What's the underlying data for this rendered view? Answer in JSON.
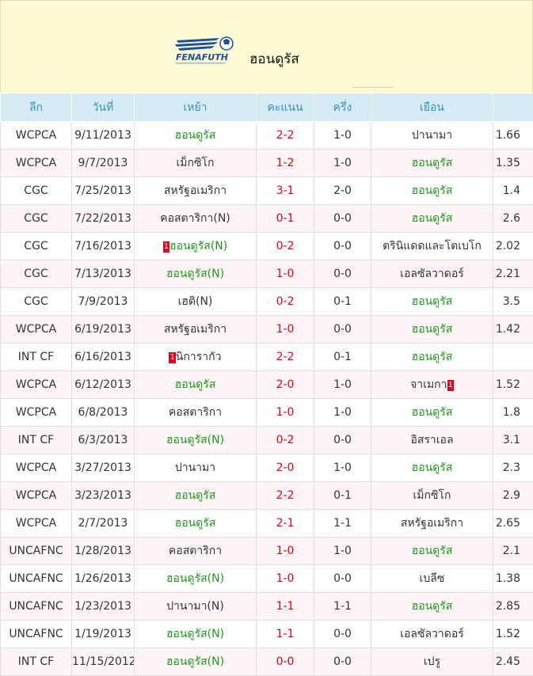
{
  "header": {
    "team_name": "ฮอนดูรัส",
    "logo_text": "FENAFUTH",
    "colors": {
      "background": "#fdfbd4",
      "table_header": "#d6ecf5",
      "header_text": "#3a8fc6",
      "score": "#e4001b",
      "highlight": "#1f9a1f",
      "red_card": "#e4001b"
    }
  },
  "table": {
    "columns": [
      "ลีก",
      "วันที่",
      "เหย้า",
      "คะแนน",
      "ครึ่ง",
      "เยือน",
      ""
    ],
    "rows": [
      {
        "league": "WCPCA",
        "date": "9/11/2013",
        "home": "ฮอนดูรัส",
        "home_hl": true,
        "home_card": "",
        "score": "2-2",
        "half": "1-0",
        "away": "ปานามา",
        "away_hl": false,
        "away_card": "",
        "odds": "1.66"
      },
      {
        "league": "WCPCA",
        "date": "9/7/2013",
        "home": "เม็กซิโก",
        "home_hl": false,
        "home_card": "",
        "score": "1-2",
        "half": "1-0",
        "away": "ฮอนดูรัส",
        "away_hl": true,
        "away_card": "",
        "odds": "1.35"
      },
      {
        "league": "CGC",
        "date": "7/25/2013",
        "home": "สหรัฐอเมริกา",
        "home_hl": false,
        "home_card": "",
        "score": "3-1",
        "half": "2-0",
        "away": "ฮอนดูรัส",
        "away_hl": true,
        "away_card": "",
        "odds": "1.4"
      },
      {
        "league": "CGC",
        "date": "7/22/2013",
        "home": "คอสตาริกา(N)",
        "home_hl": false,
        "home_card": "",
        "score": "0-1",
        "half": "0-0",
        "away": "ฮอนดูรัส",
        "away_hl": true,
        "away_card": "",
        "odds": "2.6"
      },
      {
        "league": "CGC",
        "date": "7/16/2013",
        "home": "ฮอนดูรัส(N)",
        "home_hl": true,
        "home_card": "1",
        "score": "0-2",
        "half": "0-0",
        "away": "ตรินิแดดและโตเบโก",
        "away_hl": false,
        "away_card": "",
        "odds": "2.02"
      },
      {
        "league": "CGC",
        "date": "7/13/2013",
        "home": "ฮอนดูรัส(N)",
        "home_hl": true,
        "home_card": "",
        "score": "1-0",
        "half": "0-0",
        "away": "เอลซัลวาดอร์",
        "away_hl": false,
        "away_card": "",
        "odds": "2.21"
      },
      {
        "league": "CGC",
        "date": "7/9/2013",
        "home": "เฮติ(N)",
        "home_hl": false,
        "home_card": "",
        "score": "0-2",
        "half": "0-1",
        "away": "ฮอนดูรัส",
        "away_hl": true,
        "away_card": "",
        "odds": "3.5"
      },
      {
        "league": "WCPCA",
        "date": "6/19/2013",
        "home": "สหรัฐอเมริกา",
        "home_hl": false,
        "home_card": "",
        "score": "1-0",
        "half": "0-0",
        "away": "ฮอนดูรัส",
        "away_hl": true,
        "away_card": "",
        "odds": "1.42"
      },
      {
        "league": "INT CF",
        "date": "6/16/2013",
        "home": "นิการากัว",
        "home_hl": false,
        "home_card": "1",
        "score": "2-2",
        "half": "0-1",
        "away": "ฮอนดูรัส",
        "away_hl": true,
        "away_card": "",
        "odds": ""
      },
      {
        "league": "WCPCA",
        "date": "6/12/2013",
        "home": "ฮอนดูรัส",
        "home_hl": true,
        "home_card": "",
        "score": "2-0",
        "half": "1-0",
        "away": "จาเมกา",
        "away_hl": false,
        "away_card": "1",
        "odds": "1.52"
      },
      {
        "league": "WCPCA",
        "date": "6/8/2013",
        "home": "คอสตาริกา",
        "home_hl": false,
        "home_card": "",
        "score": "1-0",
        "half": "1-0",
        "away": "ฮอนดูรัส",
        "away_hl": true,
        "away_card": "",
        "odds": "1.8"
      },
      {
        "league": "INT CF",
        "date": "6/3/2013",
        "home": "ฮอนดูรัส(N)",
        "home_hl": true,
        "home_card": "",
        "score": "0-2",
        "half": "0-0",
        "away": "อิสราเอล",
        "away_hl": false,
        "away_card": "",
        "odds": "3.1"
      },
      {
        "league": "WCPCA",
        "date": "3/27/2013",
        "home": "ปานามา",
        "home_hl": false,
        "home_card": "",
        "score": "2-0",
        "half": "1-0",
        "away": "ฮอนดูรัส",
        "away_hl": true,
        "away_card": "",
        "odds": "2.3"
      },
      {
        "league": "WCPCA",
        "date": "3/23/2013",
        "home": "ฮอนดูรัส",
        "home_hl": true,
        "home_card": "",
        "score": "2-2",
        "half": "0-1",
        "away": "เม็กซิโก",
        "away_hl": false,
        "away_card": "",
        "odds": "2.9"
      },
      {
        "league": "WCPCA",
        "date": "2/7/2013",
        "home": "ฮอนดูรัส",
        "home_hl": true,
        "home_card": "",
        "score": "2-1",
        "half": "1-1",
        "away": "สหรัฐอเมริกา",
        "away_hl": false,
        "away_card": "",
        "odds": "2.65"
      },
      {
        "league": "UNCAFNC",
        "date": "1/28/2013",
        "home": "คอสตาริกา",
        "home_hl": false,
        "home_card": "",
        "score": "1-0",
        "half": "1-0",
        "away": "ฮอนดูรัส",
        "away_hl": true,
        "away_card": "",
        "odds": "2.1"
      },
      {
        "league": "UNCAFNC",
        "date": "1/26/2013",
        "home": "ฮอนดูรัส(N)",
        "home_hl": true,
        "home_card": "",
        "score": "1-0",
        "half": "0-0",
        "away": "เบลีซ",
        "away_hl": false,
        "away_card": "",
        "odds": "1.38"
      },
      {
        "league": "UNCAFNC",
        "date": "1/23/2013",
        "home": "ปานามา(N)",
        "home_hl": false,
        "home_card": "",
        "score": "1-1",
        "half": "1-1",
        "away": "ฮอนดูรัส",
        "away_hl": true,
        "away_card": "",
        "odds": "2.85"
      },
      {
        "league": "UNCAFNC",
        "date": "1/19/2013",
        "home": "ฮอนดูรัส(N)",
        "home_hl": true,
        "home_card": "",
        "score": "1-1",
        "half": "0-0",
        "away": "เอลซัลวาดอร์",
        "away_hl": false,
        "away_card": "",
        "odds": "1.52"
      },
      {
        "league": "INT CF",
        "date": "11/15/2012",
        "home": "ฮอนดูรัส(N)",
        "home_hl": true,
        "home_card": "",
        "score": "0-0",
        "half": "0-0",
        "away": "เปรู",
        "away_hl": false,
        "away_card": "",
        "odds": "2.45"
      }
    ]
  }
}
